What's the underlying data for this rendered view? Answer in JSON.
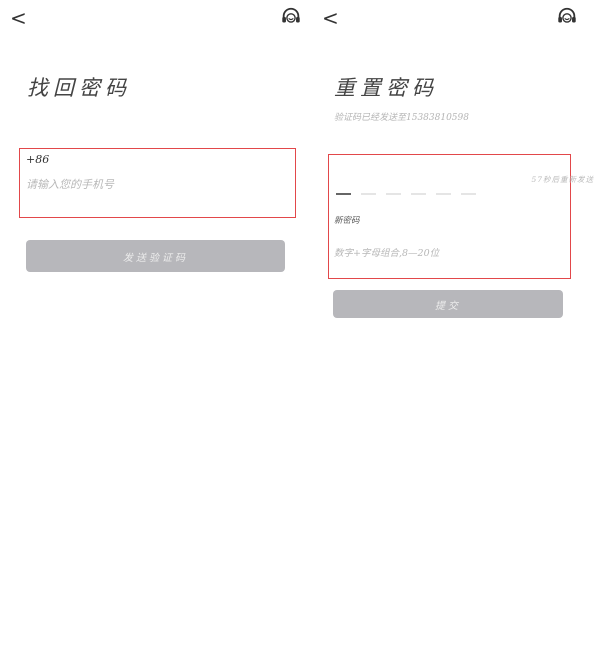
{
  "left_screen": {
    "back_icon": "chevron-left",
    "support_icon": "headset-icon",
    "title": "找回密码",
    "country_code": "+86",
    "phone_placeholder": "请输入您的手机号",
    "send_button": "发送验证码"
  },
  "right_screen": {
    "back_icon": "chevron-left",
    "support_icon": "headset-icon",
    "title": "重置密码",
    "subtitle": "验证码已经发送至15383810598",
    "resend_text": "57秒后重新发送",
    "code_length": 6,
    "new_password_label": "新密码",
    "password_placeholder": "数字+字母组合,8—20位",
    "submit_button": "提交"
  },
  "colors": {
    "button_bg": "#b7b7bb",
    "highlight_border": "#e2474a"
  }
}
